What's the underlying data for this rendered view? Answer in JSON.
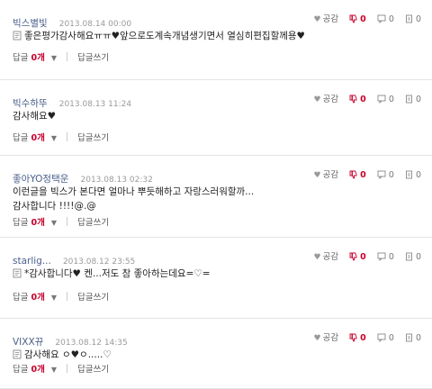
{
  "comments": [
    {
      "author": "빅스별빛",
      "date": "2013.08.14 00:00",
      "like_label": "공감",
      "dislike_count": "0",
      "reply_count": "0",
      "view_count": "0",
      "lines": [
        "좋은평가감사해요ㅠㅠ♥앞으로도계속개념생기면서 열심히편집할께용♥"
      ],
      "memo_icon": true,
      "reply_label": "답글",
      "reply_count_footer": "0개",
      "write_reply_label": "답글쓰기"
    },
    {
      "author": "빅수하뚜",
      "date": "2013.08.13 11:24",
      "like_label": "공감",
      "dislike_count": "0",
      "reply_count": "0",
      "view_count": "0",
      "lines": [
        "감사해요♥"
      ],
      "memo_icon": false,
      "reply_label": "답글",
      "reply_count_footer": "0개",
      "write_reply_label": "답글쓰기"
    },
    {
      "author": "좋아YO정택운",
      "date": "2013.08.13 02:32",
      "like_label": "공감",
      "dislike_count": "0",
      "reply_count": "0",
      "view_count": "0",
      "lines": [
        "이런글을 빅스가 본다면 얼마나 뿌듯해하고 자랑스러워할까...",
        "감사합니다 !!!!@.@"
      ],
      "memo_icon": false,
      "reply_label": "답글",
      "reply_count_footer": "0개",
      "write_reply_label": "답글쓰기"
    },
    {
      "author": "starlig...",
      "date": "2013.08.12 23:55",
      "like_label": "공감",
      "dislike_count": "0",
      "reply_count": "0",
      "view_count": "0",
      "lines": [
        "*감사합니다♥ 켄...저도 참 좋아하는데요=♡="
      ],
      "memo_icon": true,
      "reply_label": "답글",
      "reply_count_footer": "0개",
      "write_reply_label": "답글쓰기"
    },
    {
      "author": "VIXX뀨",
      "date": "2013.08.12 14:35",
      "like_label": "공감",
      "dislike_count": "0",
      "reply_count": "0",
      "view_count": "0",
      "lines": [
        "감사해요 ㅇ♥ㅇ.....♡"
      ],
      "memo_icon": true,
      "reply_label": "답글",
      "reply_count_footer": "0개",
      "write_reply_label": "답글쓰기"
    }
  ]
}
